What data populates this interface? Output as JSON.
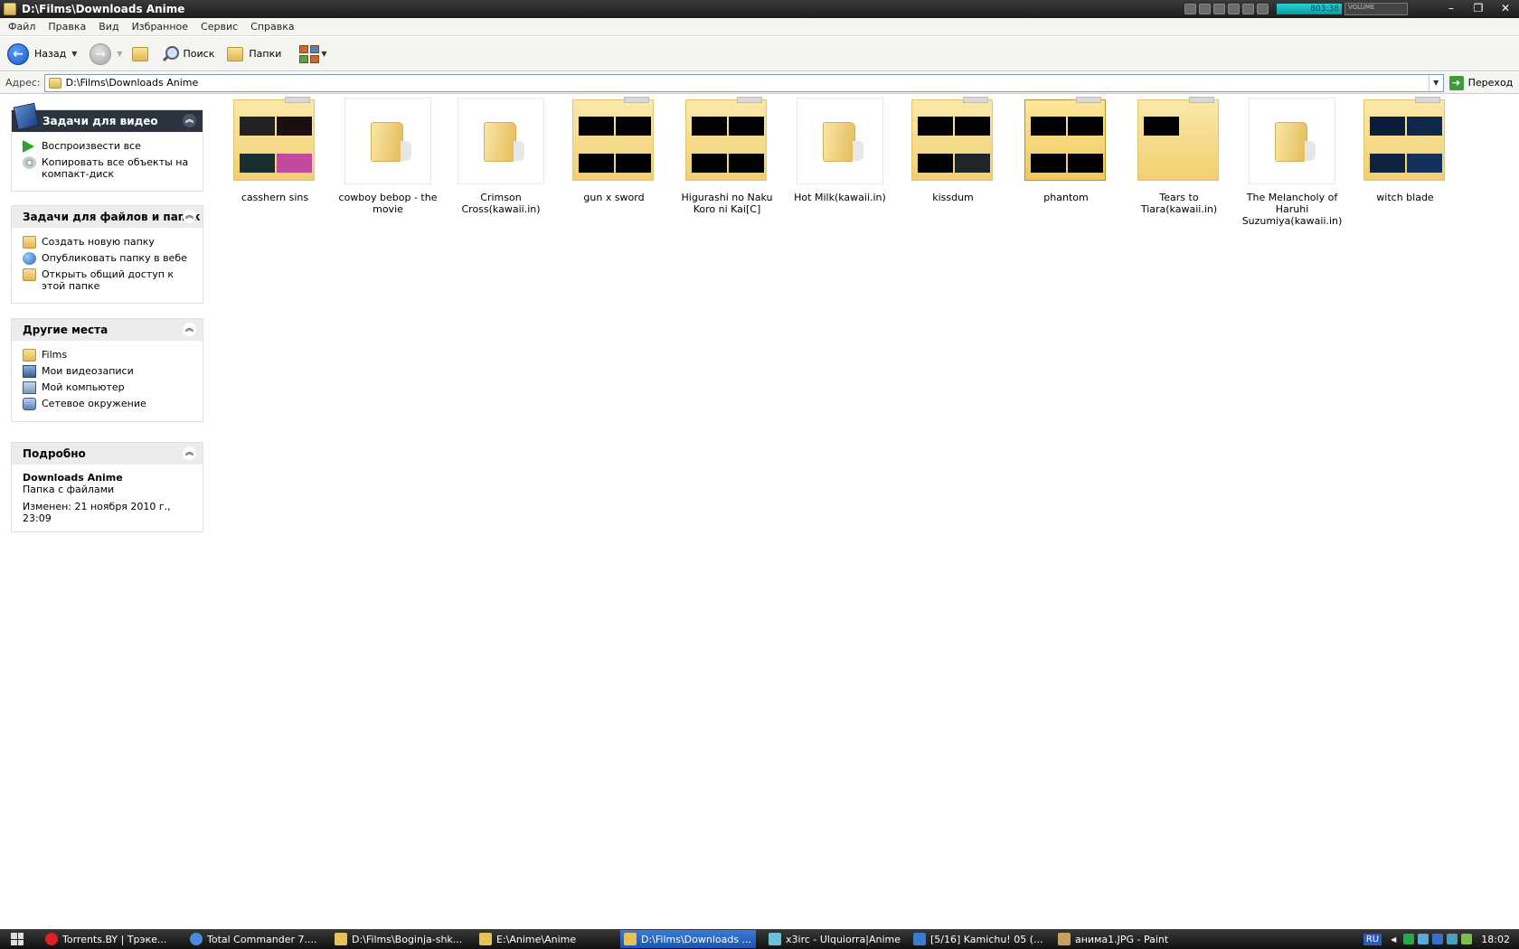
{
  "window": {
    "title": "D:\\Films\\Downloads Anime",
    "media_time": "803:38",
    "media_volume_label": "VOLUME"
  },
  "menu": [
    "Файл",
    "Правка",
    "Вид",
    "Избранное",
    "Сервис",
    "Справка"
  ],
  "toolbar": {
    "back_label": "Назад",
    "search_label": "Поиск",
    "folders_label": "Папки"
  },
  "address": {
    "label": "Адрес:",
    "value": "D:\\Films\\Downloads Anime",
    "go_label": "Переход"
  },
  "tasks": {
    "video": {
      "title": "Задачи для видео",
      "items": [
        "Воспроизвести все",
        "Копировать все объекты на компакт-диск"
      ]
    },
    "files": {
      "title": "Задачи для файлов и папок",
      "items": [
        "Создать новую папку",
        "Опубликовать папку в вебе",
        "Открыть общий доступ к этой папке"
      ]
    },
    "places": {
      "title": "Другие места",
      "items": [
        "Films",
        "Мои видеозаписи",
        "Мой компьютер",
        "Сетевое окружение"
      ]
    },
    "details": {
      "title": "Подробно",
      "name": "Downloads Anime",
      "type": "Папка с файлами",
      "modified": "Изменен: 21 ноября 2010 г., 23:09"
    }
  },
  "files": [
    {
      "name": "casshern sins"
    },
    {
      "name": "cowboy bebop - the movie"
    },
    {
      "name": "Crimson Cross(kawaii.in)"
    },
    {
      "name": "gun x sword"
    },
    {
      "name": "Higurashi no Naku Koro ni Kai[C]"
    },
    {
      "name": "Hot Milk(kawaii.in)"
    },
    {
      "name": "kissdum"
    },
    {
      "name": "phantom"
    },
    {
      "name": "Tears to Tiara(kawaii.in)"
    },
    {
      "name": "The Melancholy of Haruhi Suzumiya(kawaii.in)"
    },
    {
      "name": "witch blade"
    }
  ],
  "taskbar": {
    "tasks": [
      "Torrents.BY | Трэке...",
      "Total Commander 7....",
      "D:\\Films\\Boginja-shk...",
      "E:\\Anime\\Anime",
      "D:\\Films\\Downloads ...",
      "x3irc - Ulquiorra|Anime",
      "[5/16] Kamichu! 05 (...",
      "анима1.JPG - Paint"
    ],
    "lang": "RU",
    "clock": "18:02"
  }
}
